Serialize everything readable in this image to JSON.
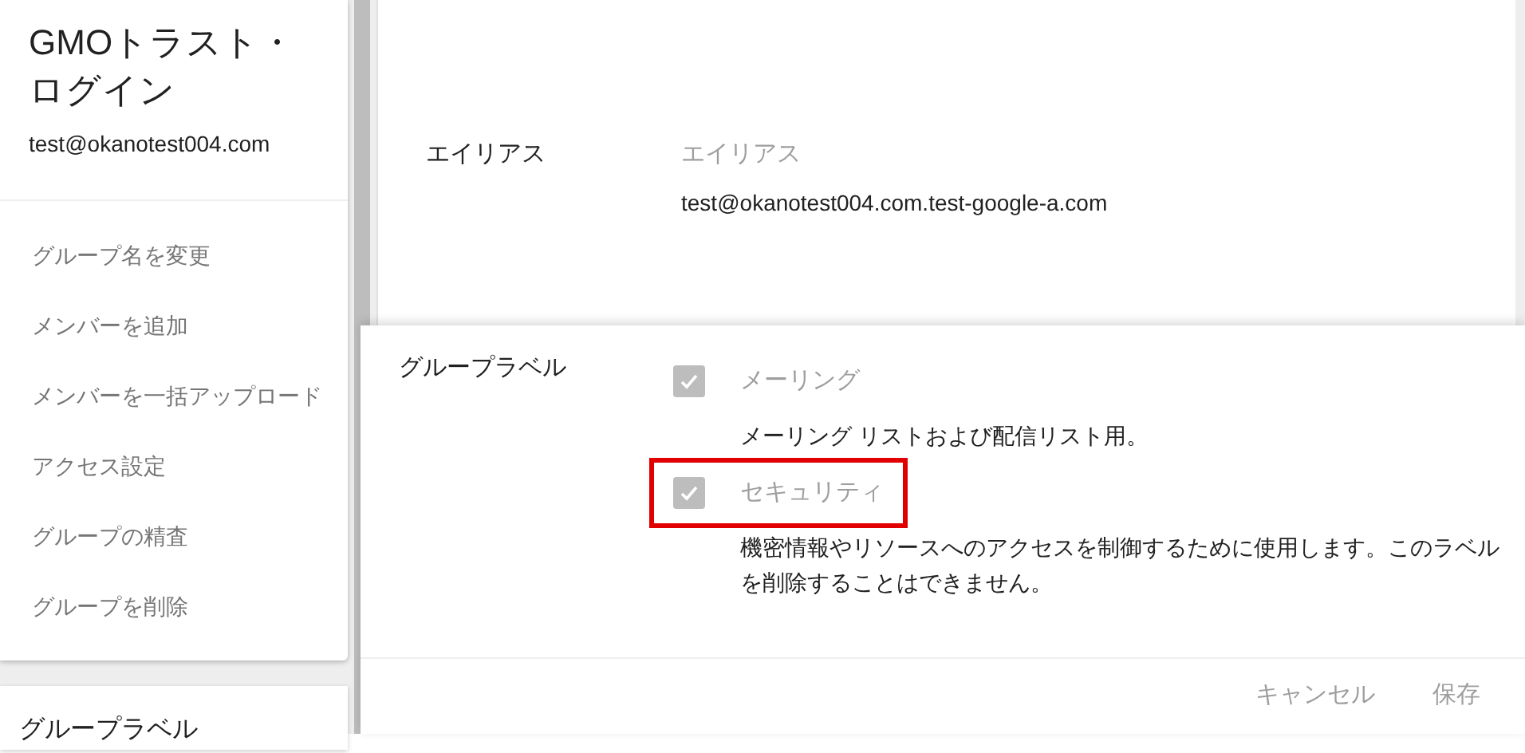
{
  "sidebar": {
    "title": "GMOトラスト・ログイン",
    "email": "test@okanotest004.com",
    "items": [
      {
        "label": "グループ名を変更"
      },
      {
        "label": "メンバーを追加"
      },
      {
        "label": "メンバーを一括アップロード"
      },
      {
        "label": "アクセス設定"
      },
      {
        "label": "グループの精査"
      },
      {
        "label": "グループを削除"
      }
    ],
    "section_title": "グループラベル"
  },
  "alias": {
    "label": "エイリアス",
    "field_label": "エイリアス",
    "value": "test@okanotest004.com.test-google-a.com"
  },
  "labels_dialog": {
    "title": "グループラベル",
    "options": [
      {
        "label": "メーリング",
        "description": "メーリング リストおよび配信リスト用。",
        "checked": true,
        "disabled": true,
        "highlighted": false
      },
      {
        "label": "セキュリティ",
        "description": "機密情報やリソースへのアクセスを制御するために使用します。このラベルを削除することはできません。",
        "checked": true,
        "disabled": true,
        "highlighted": true
      }
    ],
    "buttons": [
      "キャンセル",
      "保存"
    ]
  }
}
